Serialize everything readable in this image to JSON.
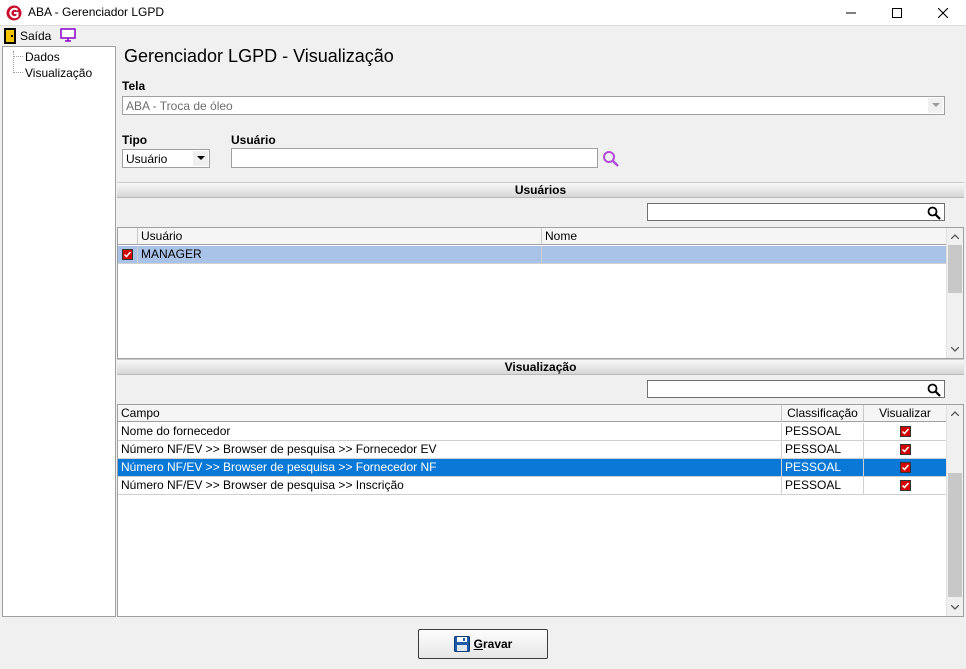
{
  "window": {
    "title": "ABA - Gerenciador LGPD"
  },
  "menu": {
    "exit_label": "Saída"
  },
  "tree": {
    "items": [
      "Dados",
      "Visualização"
    ]
  },
  "page": {
    "title": "Gerenciador LGPD - Visualização"
  },
  "form": {
    "tela_label": "Tela",
    "tela_value": "ABA - Troca de óleo",
    "tipo_label": "Tipo",
    "tipo_value": "Usuário",
    "usuario_label": "Usuário",
    "usuario_value": ""
  },
  "usuarios": {
    "section_title": "Usuários",
    "search_value": "",
    "columns": [
      "Usuário",
      "Nome"
    ],
    "rows": [
      {
        "checked": true,
        "usuario": "MANAGER",
        "nome": ""
      }
    ]
  },
  "visualizacao": {
    "section_title": "Visualização",
    "search_value": "",
    "columns": [
      "Campo",
      "Classificação",
      "Visualizar"
    ],
    "rows": [
      {
        "campo": "Nome do fornecedor",
        "classificacao": "PESSOAL",
        "visualizar": true
      },
      {
        "campo": "Número NF/EV >> Browser de pesquisa >> Fornecedor EV",
        "classificacao": "PESSOAL",
        "visualizar": true
      },
      {
        "campo": "Número NF/EV >> Browser de pesquisa >> Fornecedor NF",
        "classificacao": "PESSOAL",
        "visualizar": true
      },
      {
        "campo": "Número NF/EV >> Browser de pesquisa >> Inscrição",
        "classificacao": "PESSOAL",
        "visualizar": true
      }
    ],
    "selected_row": 2
  },
  "actions": {
    "save_label_first": "G",
    "save_label_rest": "ravar"
  },
  "colors": {
    "selection_dark": "#0a78d7",
    "selection_light": "#a9c2e8",
    "check_red": "#d40000"
  }
}
